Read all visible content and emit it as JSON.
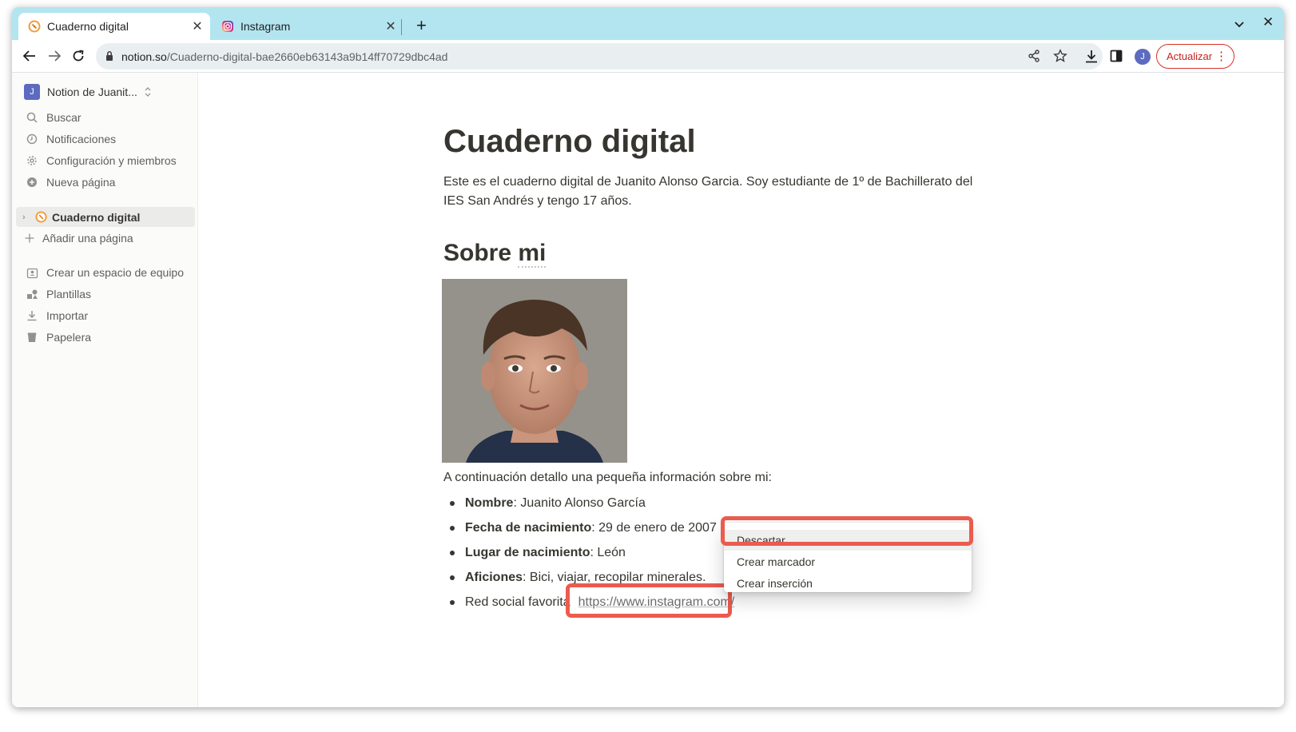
{
  "browser": {
    "tabs": [
      {
        "title": "Cuaderno digital",
        "active": true,
        "favicon": "notion-page-icon"
      },
      {
        "title": "Instagram",
        "active": false,
        "favicon": "instagram-icon"
      }
    ],
    "url_host": "notion.so",
    "url_path": "/Cuaderno-digital-bae2660eb63143a9b14ff70729dbc4ad",
    "profile_initial": "J",
    "update_label": "Actualizar"
  },
  "sidebar": {
    "workspace_initial": "J",
    "workspace_name": "Notion de Juanit...",
    "items": [
      {
        "label": "Buscar",
        "icon": "search-icon"
      },
      {
        "label": "Notificaciones",
        "icon": "clock-icon"
      },
      {
        "label": "Configuración y miembros",
        "icon": "gear-icon"
      },
      {
        "label": "Nueva página",
        "icon": "plus-circle-icon"
      }
    ],
    "page": {
      "label": "Cuaderno digital"
    },
    "add_page": "Añadir una página",
    "bottom_items": [
      {
        "label": "Crear un espacio de equipo",
        "icon": "team-icon"
      },
      {
        "label": "Plantillas",
        "icon": "templates-icon"
      },
      {
        "label": "Importar",
        "icon": "download-icon"
      },
      {
        "label": "Papelera",
        "icon": "trash-icon"
      }
    ]
  },
  "page": {
    "title": "Cuaderno digital",
    "intro": "Este es el cuaderno digital de Juanito Alonso Garcia. Soy estudiante de 1º de Bachillerato del IES San Andrés y tengo 17 años.",
    "section_heading_a": "Sobre ",
    "section_heading_b": "mi",
    "paragraph": "A continuación detallo una pequeña información sobre mi:",
    "bullets": [
      {
        "key": "Nombre",
        "value": ": Juanito Alonso García"
      },
      {
        "key": "Fecha de nacimiento",
        "value": ": 29 de enero de 2007"
      },
      {
        "key": "Lugar de nacimiento",
        "value": ": León"
      },
      {
        "key": "Aficiones",
        "value": ": Bici, viajar, recopilar minerales."
      }
    ],
    "social_label": "Red social favorita",
    "social_link": "https://www.instagram.com/"
  },
  "context_menu": {
    "items": [
      "Descartar",
      "Crear marcador",
      "Crear inserción"
    ]
  },
  "colors": {
    "highlight": "#eb5b4e",
    "tab_strip": "#b3e5f0",
    "text": "#37352f"
  }
}
